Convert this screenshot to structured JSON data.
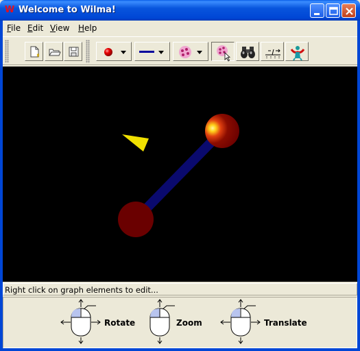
{
  "window": {
    "title": "Welcome to Wilma!",
    "app_icon": "W",
    "controls": [
      "minimize-icon",
      "maximize-icon",
      "close-icon"
    ]
  },
  "menu": {
    "items": [
      {
        "label": "File",
        "underline": "F",
        "rest": "ile"
      },
      {
        "label": "Edit",
        "underline": "E",
        "rest": "dit"
      },
      {
        "label": "View",
        "underline": "V",
        "rest": "iew"
      },
      {
        "label": "Help",
        "underline": "H",
        "rest": "elp"
      }
    ]
  },
  "toolbar": {
    "buttons": [
      {
        "name": "new-file",
        "icon": "new-document-icon"
      },
      {
        "name": "open-file",
        "icon": "open-folder-icon"
      },
      {
        "name": "save-file",
        "icon": "save-disk-icon"
      },
      {
        "name": "node-style",
        "icon": "red-sphere-icon",
        "dropdown": true
      },
      {
        "name": "edge-style",
        "icon": "blue-line-icon",
        "dropdown": true
      },
      {
        "name": "cluster-style",
        "icon": "pink-cluster-icon",
        "dropdown": true
      },
      {
        "name": "select-cluster",
        "icon": "cluster-pointer-icon"
      },
      {
        "name": "find",
        "icon": "binoculars-icon"
      },
      {
        "name": "layout",
        "icon": "graph-layout-icon"
      },
      {
        "name": "gravity",
        "icon": "figure-icon"
      }
    ],
    "colors": {
      "node": "#dd0000",
      "edge": "#00009c",
      "cluster": "#e05aa0"
    }
  },
  "graph": {
    "background": "#000000",
    "nodes": [
      {
        "id": "node-1",
        "color": "#6a0000",
        "highlight": "#ffdb1a"
      },
      {
        "id": "node-2",
        "color": "#6a0000"
      }
    ],
    "edge_color": "#0a0a6e",
    "cursor_color": "#ffff00"
  },
  "status": {
    "text": "Right click on graph elements to edit..."
  },
  "help": {
    "rotate": "Rotate",
    "zoom": "Zoom",
    "translate": "Translate"
  }
}
